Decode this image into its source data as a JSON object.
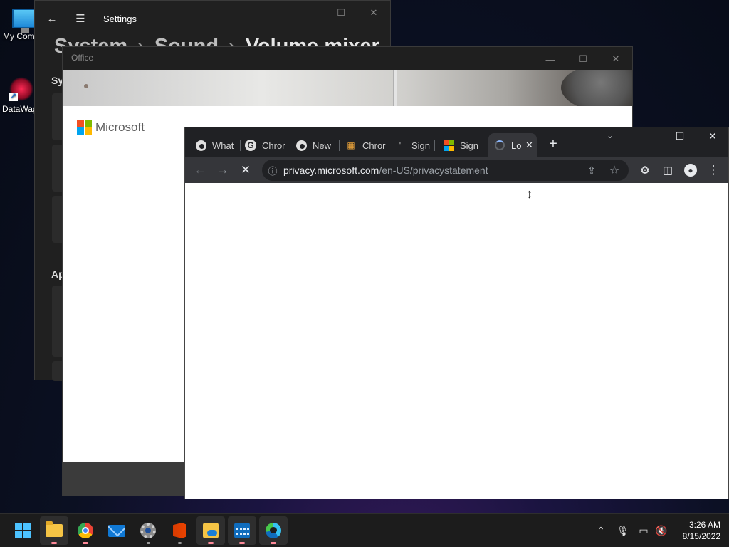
{
  "desktop": {
    "icons": [
      {
        "label": "My Com",
        "icon": "computer-icon"
      },
      {
        "label": "DataWag",
        "icon": "datawagon-icon"
      }
    ]
  },
  "settings": {
    "title": "Settings",
    "breadcrumb": {
      "part1": "System",
      "part2": "Sound",
      "part3": "Volume mixer",
      "separator": "›"
    },
    "nav_label_1": "Sys",
    "nav_label_2": "Ap",
    "icons": {
      "back": "back-arrow-icon",
      "menu": "hamburger-menu-icon"
    }
  },
  "office": {
    "title": "Office",
    "brand": "Microsoft",
    "logo_colors": [
      "#f25022",
      "#7fba00",
      "#00a4ef",
      "#ffb900"
    ]
  },
  "chrome": {
    "tabs": [
      {
        "label": "What",
        "favicon": "chrome-icon"
      },
      {
        "label": "Chror",
        "favicon": "google-icon"
      },
      {
        "label": "New",
        "favicon": "chrome-icon"
      },
      {
        "label": "Chror",
        "favicon": "chrome-web-store-icon"
      },
      {
        "label": "Sign",
        "favicon": "loading-dot-icon"
      },
      {
        "label": "Sign",
        "favicon": "microsoft-icon"
      },
      {
        "label": "Lo",
        "favicon": "loading-spinner-icon",
        "active": true
      }
    ],
    "url_host": "privacy.microsoft.com",
    "url_path": "/en-US/privacystatement",
    "loading": true,
    "icons": {
      "back": "back-icon",
      "forward": "forward-icon",
      "stop": "stop-loading-icon",
      "info": "site-info-icon",
      "share": "share-icon",
      "bookmark": "star-icon",
      "extensions": "puzzle-icon",
      "side_panel": "side-panel-icon",
      "profile": "profile-icon",
      "menu": "kebab-menu-icon"
    }
  },
  "taskbar": {
    "apps": [
      {
        "name": "start",
        "open": false
      },
      {
        "name": "file-explorer",
        "open": true
      },
      {
        "name": "chrome",
        "open": false
      },
      {
        "name": "mail",
        "open": false
      },
      {
        "name": "settings",
        "open": false
      },
      {
        "name": "office",
        "open": false
      },
      {
        "name": "files",
        "open": true
      },
      {
        "name": "calendar",
        "open": true
      },
      {
        "name": "edge",
        "open": true
      }
    ],
    "tray_icons": [
      "chevron-up-icon",
      "microphone-icon",
      "network-icon",
      "volume-muted-icon"
    ],
    "time": "3:26 AM",
    "date": "8/15/2022"
  },
  "colors": {
    "accent": "#4cc2ff",
    "chrome_dark": "#202124",
    "chrome_toolbar": "#35363a"
  }
}
